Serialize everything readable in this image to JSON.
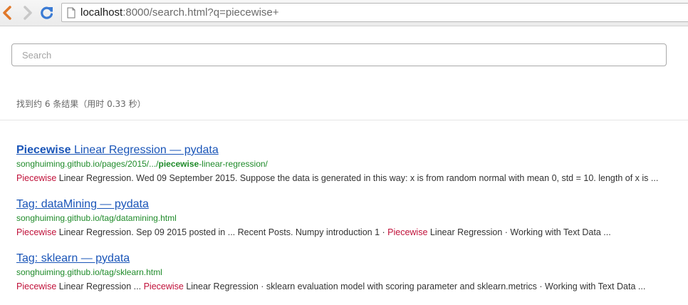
{
  "browser": {
    "url_host": "localhost",
    "url_rest": ":8000/search.html?q=piecewise+"
  },
  "search": {
    "placeholder": "Search",
    "value": ""
  },
  "stats": "找到约 6 条结果（用时 0.33 秒）",
  "results": [
    {
      "title_highlight": "Piecewise",
      "title_rest": " Linear Regression — pydata",
      "url_before": "songhuiming.github.io/pages/2015/.../",
      "url_highlight": "piecewise",
      "url_after": "-linear-regression/",
      "snippet": [
        {
          "text": "Piecewise",
          "hl": true
        },
        {
          "text": " Linear Regression. Wed 09 September 2015. Suppose the data is generated in this way: x is from random normal with mean 0, std = 10. length of x is ...",
          "hl": false
        }
      ]
    },
    {
      "title_highlight": "",
      "title_rest": "Tag: dataMining — pydata",
      "url_before": "songhuiming.github.io/tag/datamining.html",
      "url_highlight": "",
      "url_after": "",
      "snippet": [
        {
          "text": "Piecewise",
          "hl": true
        },
        {
          "text": " Linear Regression. Sep 09 2015 posted in ... Recent Posts. Numpy introduction 1 · ",
          "hl": false
        },
        {
          "text": "Piecewise",
          "hl": true
        },
        {
          "text": " Linear Regression · Working with Text Data ...",
          "hl": false
        }
      ]
    },
    {
      "title_highlight": "",
      "title_rest": "Tag: sklearn — pydata",
      "url_before": "songhuiming.github.io/tag/sklearn.html",
      "url_highlight": "",
      "url_after": "",
      "snippet": [
        {
          "text": "Piecewise",
          "hl": true
        },
        {
          "text": " Linear Regression ... ",
          "hl": false
        },
        {
          "text": "Piecewise",
          "hl": true
        },
        {
          "text": " Linear Regression · sklearn evaluation model with scoring parameter and sklearn.metrics · Working with Text Data ...",
          "hl": false
        }
      ]
    }
  ],
  "colors": {
    "link": "#1a55b8",
    "url": "#1f8b2a",
    "highlight": "#c0113a",
    "back_arrow": "#e0782a",
    "reload": "#3b7bd4"
  }
}
